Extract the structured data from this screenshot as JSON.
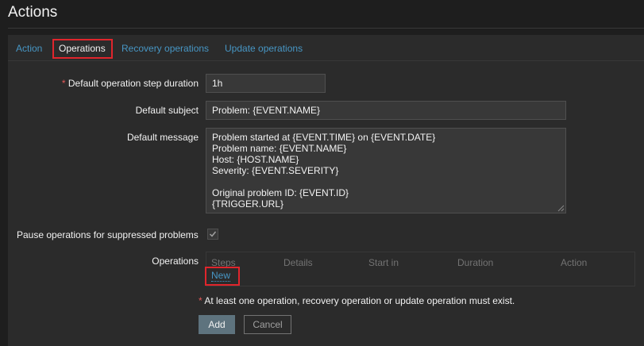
{
  "page": {
    "title": "Actions"
  },
  "tabs": [
    {
      "label": "Action",
      "active": false
    },
    {
      "label": "Operations",
      "active": true
    },
    {
      "label": "Recovery operations",
      "active": false
    },
    {
      "label": "Update operations",
      "active": false
    }
  ],
  "form": {
    "step_duration": {
      "required_mark": "*",
      "label": "Default operation step duration",
      "value": "1h"
    },
    "subject": {
      "label": "Default subject",
      "value": "Problem: {EVENT.NAME}"
    },
    "message": {
      "label": "Default message",
      "lines": [
        "Problem started at {EVENT.TIME} on {EVENT.DATE}",
        "Problem name: {EVENT.NAME}",
        "Host: {HOST.NAME}",
        "Severity: {EVENT.SEVERITY}",
        "",
        "Original problem ID: {EVENT.ID}",
        "{TRIGGER.URL}"
      ]
    },
    "pause_suppressed": {
      "label": "Pause operations for suppressed problems",
      "checked": true
    },
    "operations": {
      "label": "Operations",
      "columns": [
        "Steps",
        "Details",
        "Start in",
        "Duration",
        "Action"
      ],
      "new_link": "New"
    },
    "warning": {
      "required_mark": "*",
      "text": "At least one operation, recovery operation or update operation must exist."
    },
    "buttons": {
      "add": "Add",
      "cancel": "Cancel"
    }
  },
  "colors": {
    "background": "#1e1e1e",
    "panel": "#2b2b2b",
    "input_bg": "#383838",
    "link": "#4796c4",
    "required": "#e45959",
    "highlight": "#e0252c",
    "button_primary": "#5e737e"
  }
}
